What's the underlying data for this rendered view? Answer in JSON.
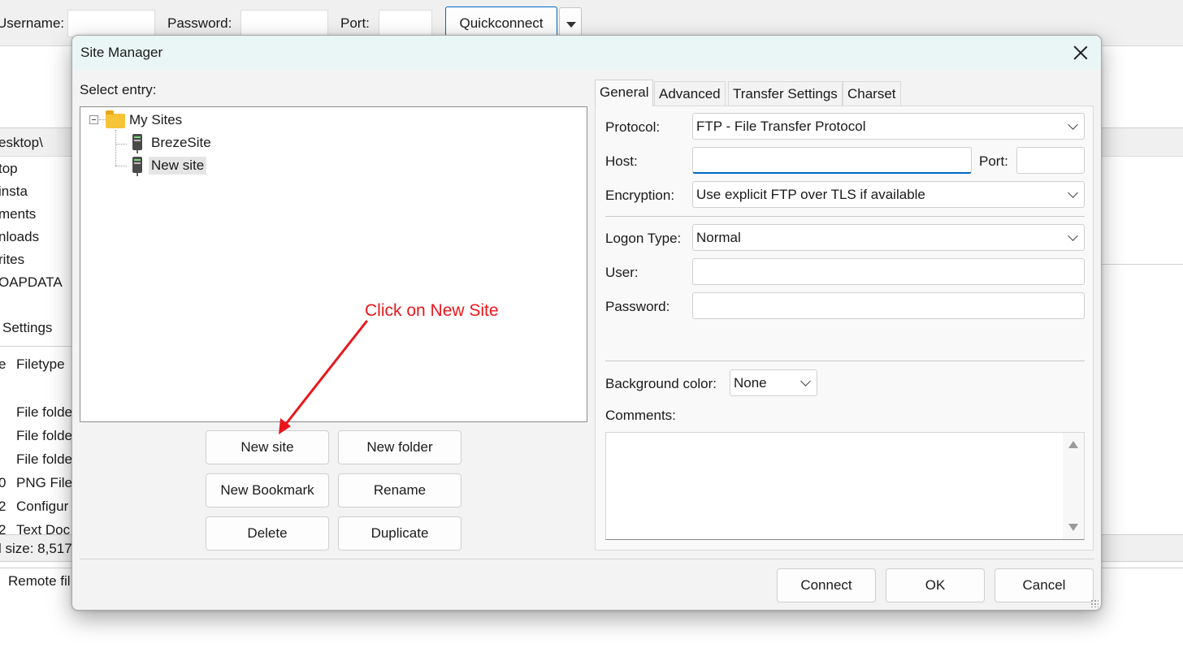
{
  "main_window": {
    "quickconnect": {
      "username_label": "Username:",
      "password_label": "Password:",
      "port_label": "Port:",
      "quickconnect_label": "Quickconnect"
    },
    "local_path": "esktop\\",
    "folder_items": [
      "top",
      "insta",
      "ments",
      "nloads",
      "rites",
      "OAPDATA"
    ],
    "settings_label": "Settings",
    "columns": {
      "size_col": "e",
      "filetype_col": "Filetype"
    },
    "file_rows": [
      {
        "size": "",
        "type": "File folde"
      },
      {
        "size": "",
        "type": "File folde"
      },
      {
        "size": "",
        "type": "File folde"
      },
      {
        "size": "0",
        "type": "PNG File"
      },
      {
        "size": "2",
        "type": "Configur"
      },
      {
        "size": "2",
        "type": "Text Doc"
      }
    ],
    "total_size": "l size: 8,517",
    "queue_tab": "Remote fil"
  },
  "dialog": {
    "title": "Site Manager",
    "select_entry_label": "Select entry:",
    "tree": {
      "root": "My Sites",
      "children": [
        {
          "label": "BrezeSite",
          "selected": false
        },
        {
          "label": "New site",
          "selected": true
        }
      ]
    },
    "buttons": {
      "new_site": "New site",
      "new_folder": "New folder",
      "new_bookmark": "New Bookmark",
      "rename": "Rename",
      "delete": "Delete",
      "duplicate": "Duplicate"
    },
    "tabs": [
      "General",
      "Advanced",
      "Transfer Settings",
      "Charset"
    ],
    "active_tab": "General",
    "general": {
      "protocol_label": "Protocol:",
      "protocol_value": "FTP - File Transfer Protocol",
      "host_label": "Host:",
      "host_value": "",
      "port_label": "Port:",
      "port_value": "",
      "encryption_label": "Encryption:",
      "encryption_value": "Use explicit FTP over TLS if available",
      "logon_type_label": "Logon Type:",
      "logon_type_value": "Normal",
      "user_label": "User:",
      "user_value": "",
      "password_label": "Password:",
      "password_value": "",
      "background_color_label": "Background color:",
      "background_color_value": "None",
      "comments_label": "Comments:",
      "comments_value": ""
    },
    "footer": {
      "connect": "Connect",
      "ok": "OK",
      "cancel": "Cancel"
    }
  },
  "annotation": {
    "text": "Click on New Site",
    "color": "#e8171c"
  },
  "colors": {
    "accent": "#0067c0",
    "titlebar": "#eaf6f5",
    "dialog_bg": "#f3f3f3"
  }
}
